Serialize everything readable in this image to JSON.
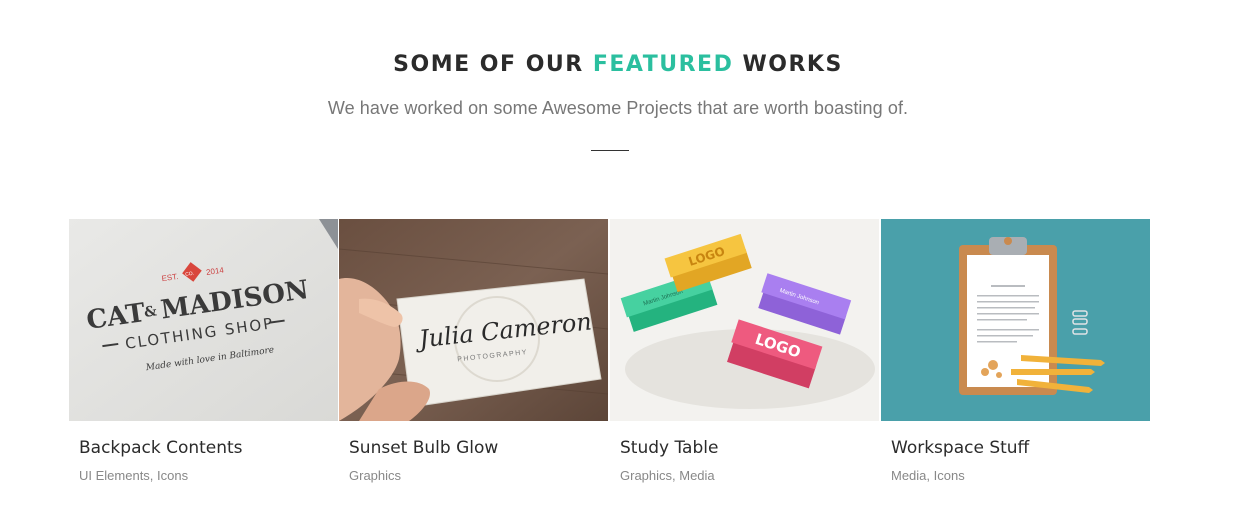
{
  "header": {
    "title_pre": "SOME OF OUR ",
    "title_accent": "FEATURED",
    "title_post": " WORKS",
    "subtitle": "We have worked on some Awesome Projects that are worth boasting of.",
    "accent_color": "#2bbf9f"
  },
  "projects": [
    {
      "title": "Backpack Contents",
      "categories": "UI Elements, Icons",
      "image": {
        "est": "EST.",
        "year": "2014",
        "badge": "CO.",
        "line1": "CAT",
        "amp": "&",
        "line1b": "MADISON",
        "line2": "CLOTHING SHOP",
        "line3": "Made with love in Baltimore"
      }
    },
    {
      "title": "Sunset Bulb Glow",
      "categories": "Graphics",
      "image": {
        "name": "Julia Cameron",
        "sub": "PHOTOGRAPHY"
      }
    },
    {
      "title": "Study Table",
      "categories": "Graphics, Media",
      "image": {
        "logo": "LOGO",
        "card_name": "Martin Johnson"
      }
    },
    {
      "title": "Workspace Stuff",
      "categories": "Media, Icons",
      "image": {}
    }
  ]
}
